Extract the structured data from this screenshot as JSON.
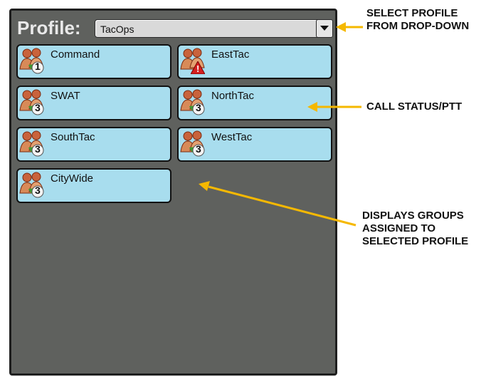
{
  "profile": {
    "label": "Profile:",
    "selected_value": "TacOps"
  },
  "groups": [
    {
      "name": "Command",
      "badge": "1",
      "badge_type": "number"
    },
    {
      "name": "EastTac",
      "badge": "!",
      "badge_type": "warning"
    },
    {
      "name": "SWAT",
      "badge": "3",
      "badge_type": "number"
    },
    {
      "name": "NorthTac",
      "badge": "3",
      "badge_type": "number"
    },
    {
      "name": "SouthTac",
      "badge": "3",
      "badge_type": "number"
    },
    {
      "name": "WestTac",
      "badge": "3",
      "badge_type": "number"
    },
    {
      "name": "CityWide",
      "badge": "3",
      "badge_type": "number"
    }
  ],
  "annotations": {
    "select_profile_line1": "SELECT PROFILE",
    "select_profile_line2": "FROM DROP-DOWN",
    "call_status": "CALL STATUS/PTT",
    "displays_line1": "DISPLAYS GROUPS",
    "displays_line2": "ASSIGNED TO",
    "displays_line3": "SELECTED PROFILE"
  },
  "colors": {
    "panel_bg": "#5f615e",
    "tile_bg": "#a8ddee",
    "arrow": "#f5b800",
    "badge_green": "#3c9a2f",
    "warning_red": "#d32020"
  },
  "icons": {
    "group": "group-people-icon",
    "dropdown": "chevron-down-icon",
    "warning": "warning-triangle-icon"
  }
}
